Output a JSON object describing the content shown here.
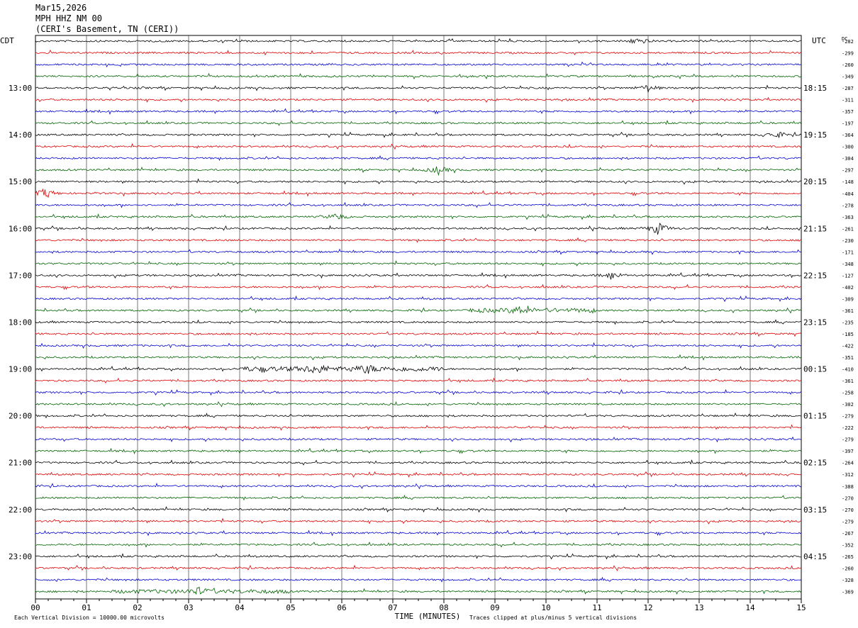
{
  "header": {
    "date": "Mar15,2026",
    "channel": "MPH HHZ NM 00",
    "location": "(CERI's Basement, TN (CERI))"
  },
  "left_tz": "CDT",
  "right_tz": "UTC",
  "dc_label": "DC",
  "footer": {
    "scale_note": "Each Vertical Division = 10000.00 microvolts",
    "xaxis_title": "TIME (MINUTES)",
    "clip_note": "Traces clipped at plus/minus 5 vertical divisions"
  },
  "colors": {
    "trace_cycle": [
      "#000000",
      "#e00000",
      "#0000d0",
      "#006400"
    ],
    "grid": "#000000"
  },
  "chart_data": {
    "type": "line",
    "title": "",
    "xlabel": "TIME (MINUTES)",
    "ylabel": "",
    "xlim": [
      0,
      15
    ],
    "x_ticks": [
      "00",
      "01",
      "02",
      "03",
      "04",
      "05",
      "06",
      "07",
      "08",
      "09",
      "10",
      "11",
      "12",
      "13",
      "14",
      "15"
    ],
    "row_count": 48,
    "left_hour_labels": [
      "13:00",
      "14:00",
      "15:00",
      "16:00",
      "17:00",
      "18:00",
      "19:00",
      "20:00",
      "21:00",
      "22:00",
      "23:00"
    ],
    "right_hour_labels": [
      "18:15",
      "19:15",
      "20:15",
      "21:15",
      "22:15",
      "23:15",
      "00:15",
      "01:15",
      "02:15",
      "03:15",
      "04:15"
    ],
    "dc_offsets": [
      "-282",
      "-299",
      "-260",
      "-349",
      "-287",
      "-311",
      "-357",
      "-197",
      "-364",
      "-300",
      "-304",
      "-297",
      "-148",
      "-404",
      "-278",
      "-363",
      "-261",
      "-230",
      "-171",
      "-348",
      "-127",
      "-402",
      "-309",
      "-361",
      "-235",
      "-185",
      "-422",
      "-351",
      "-410",
      "-361",
      "-258",
      "-302",
      "-279",
      "-222",
      "-279",
      "-397",
      "-264",
      "-312",
      "-388",
      "-270",
      "-270",
      "-279",
      "-267",
      "-352",
      "-265",
      "-260",
      "-328",
      "-369"
    ],
    "events": [
      {
        "row": 0,
        "minute": 11.8,
        "amp": 5
      },
      {
        "row": 4,
        "minute": 12.0,
        "amp": 5
      },
      {
        "row": 8,
        "minute": 14.5,
        "amp": 5
      },
      {
        "row": 11,
        "minute": 7.9,
        "amp": 6
      },
      {
        "row": 13,
        "minute": 0.2,
        "amp": 7
      },
      {
        "row": 15,
        "minute": 5.9,
        "amp": 5
      },
      {
        "row": 16,
        "minute": 12.2,
        "amp": 9
      },
      {
        "row": 20,
        "minute": 11.3,
        "amp": 5
      },
      {
        "row": 23,
        "minute": 9.5,
        "amp": 4
      },
      {
        "row": 28,
        "minute": 5.5,
        "amp": 5
      },
      {
        "row": 28,
        "minute": 6.5,
        "amp": 4
      },
      {
        "row": 47,
        "minute": 3.2,
        "amp": 4
      }
    ]
  }
}
